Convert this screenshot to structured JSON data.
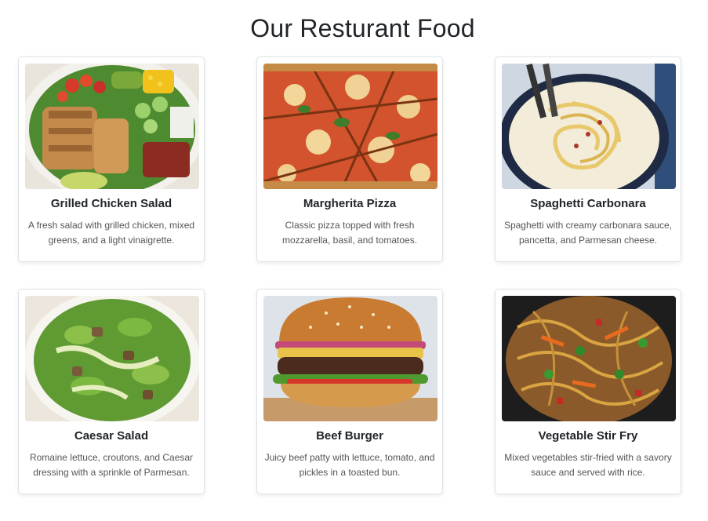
{
  "page": {
    "title": "Our Resturant Food"
  },
  "foods": [
    {
      "name": "Grilled Chicken Salad",
      "description": "A fresh salad with grilled chicken, mixed greens, and a light vinaigrette."
    },
    {
      "name": "Margherita Pizza",
      "description": "Classic pizza topped with fresh mozzarella, basil, and tomatoes."
    },
    {
      "name": "Spaghetti Carbonara",
      "description": "Spaghetti with creamy carbonara sauce, pancetta, and Parmesan cheese."
    },
    {
      "name": "Caesar Salad",
      "description": "Romaine lettuce, croutons, and Caesar dressing with a sprinkle of Parmesan."
    },
    {
      "name": "Beef Burger",
      "description": "Juicy beef patty with lettuce, tomato, and pickles in a toasted bun."
    },
    {
      "name": "Vegetable Stir Fry",
      "description": "Mixed vegetables stir-fried with a savory sauce and served with rice."
    }
  ]
}
